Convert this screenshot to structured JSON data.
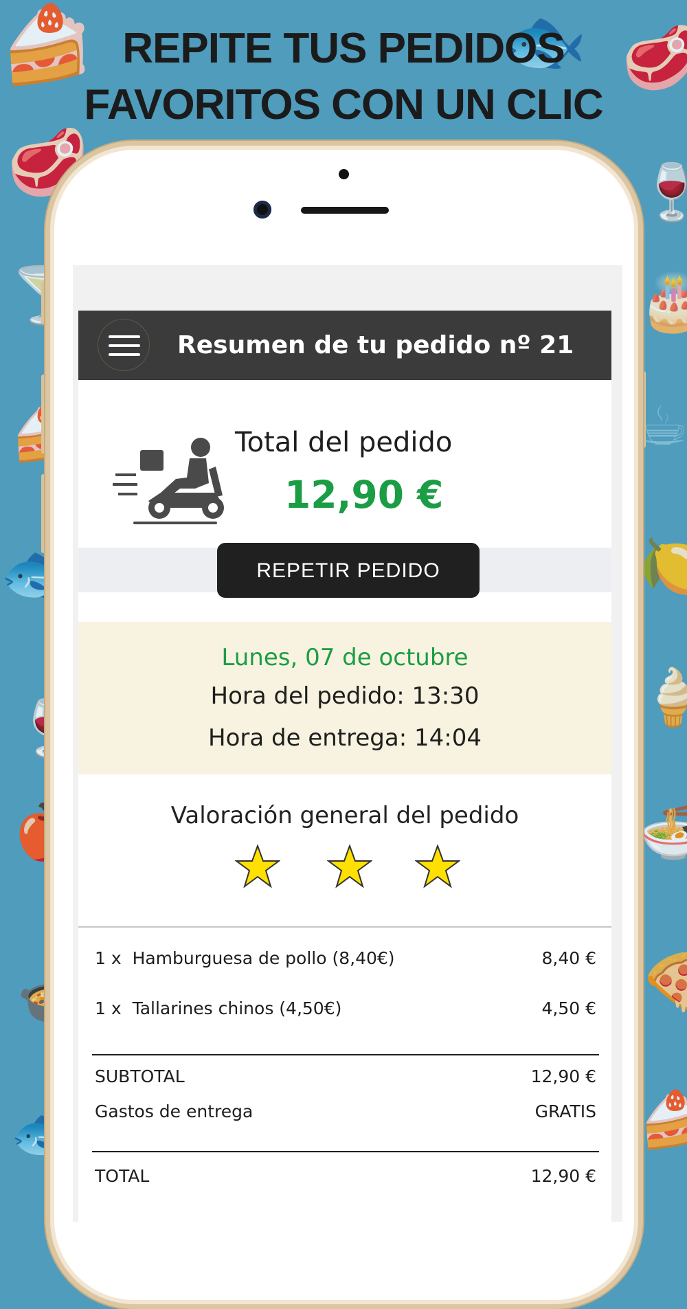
{
  "headline": {
    "line1": "REPITE TUS PEDIDOS",
    "line2": "FAVORITOS CON UN CLIC"
  },
  "appbar": {
    "title": "Resumen de tu pedido nº 21",
    "menu_icon": "hamburger-menu-icon"
  },
  "summary": {
    "icon": "delivery-scooter-icon",
    "total_label": "Total del pedido",
    "total_value": "12,90 €",
    "total_color": "#1b9d45",
    "repeat_button": "REPETIR PEDIDO"
  },
  "schedule": {
    "date": "Lunes, 07 de octubre",
    "order_time": "Hora del pedido: 13:30",
    "delivery_time": "Hora de entrega: 14:04",
    "background": "#f8f3e0"
  },
  "rating": {
    "title": "Valoración general del pedido",
    "stars": 3,
    "star_color": "#ffe000"
  },
  "items": [
    {
      "qty": "1 x",
      "name": "Hamburguesa de pollo (8,40€)",
      "price": "8,40 €"
    },
    {
      "qty": "1 x",
      "name": "Tallarines chinos (4,50€)",
      "price": "4,50 €"
    }
  ],
  "totals": {
    "subtotal_label": "SUBTOTAL",
    "subtotal_value": "12,90 €",
    "delivery_label": "Gastos de entrega",
    "delivery_value": "GRATIS",
    "total_label": "TOTAL",
    "total_value": "12,90 €"
  },
  "colors": {
    "background": "#4f9cbd",
    "appbar": "#3b3b3b",
    "button": "#202020"
  }
}
